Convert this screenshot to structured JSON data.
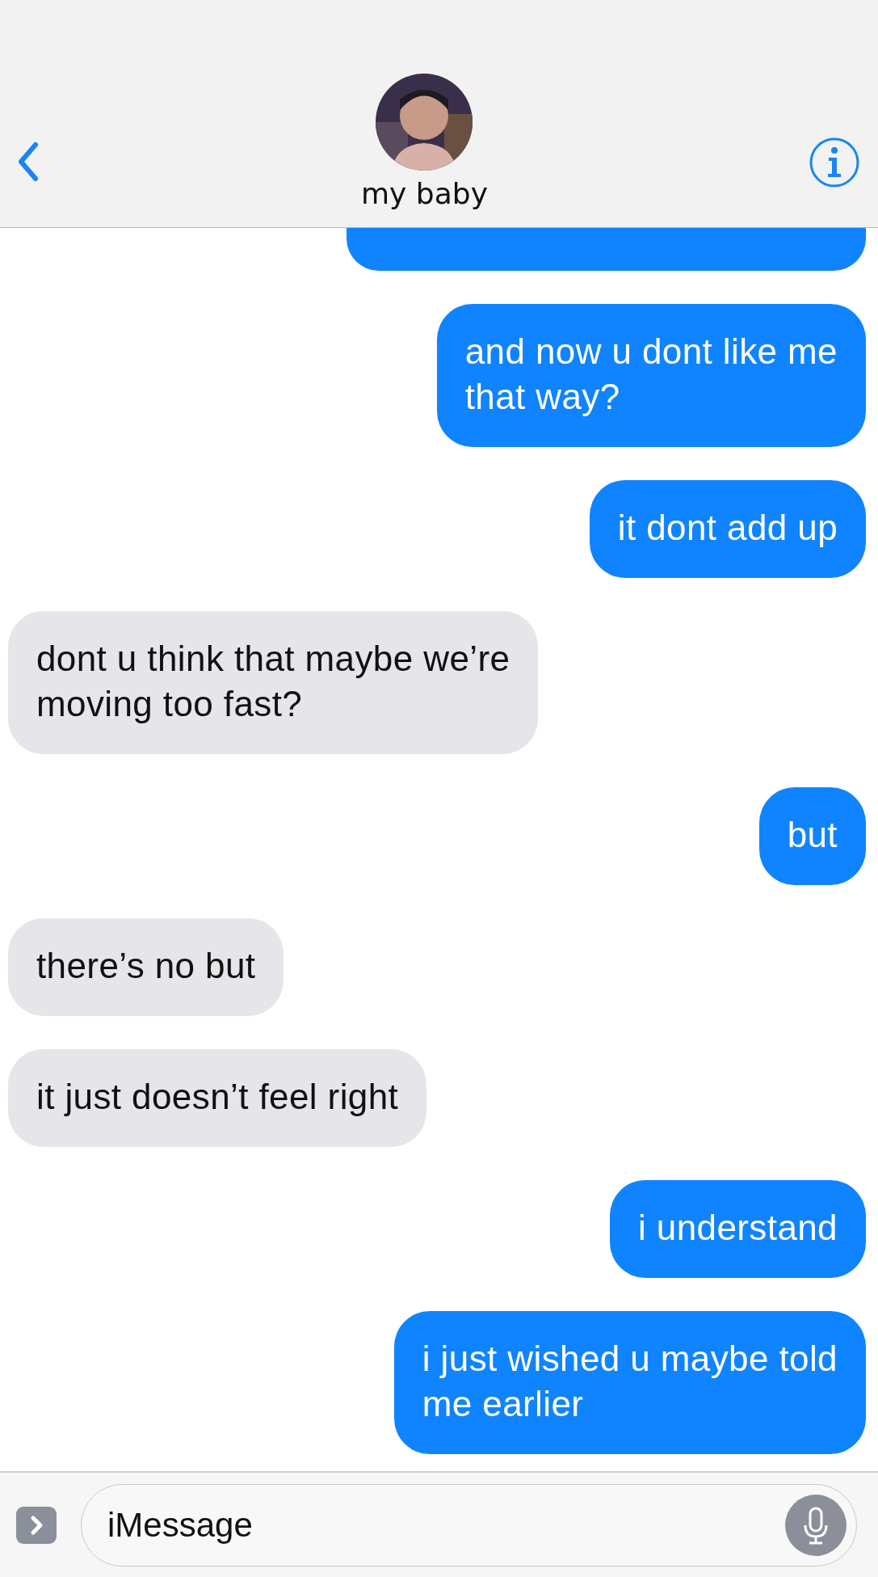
{
  "header": {
    "contact_name": "my baby"
  },
  "messages": [
    {
      "kind": "sent",
      "cut_off": true
    },
    {
      "kind": "sent",
      "cut_off": false,
      "lines": [
        "and now u dont like me",
        "that way?"
      ]
    },
    {
      "kind": "sent",
      "cut_off": false,
      "lines": [
        "it dont add up"
      ]
    },
    {
      "kind": "received",
      "cut_off": false,
      "lines": [
        "dont u think that maybe we’re",
        "moving too fast?"
      ]
    },
    {
      "kind": "sent",
      "cut_off": false,
      "lines": [
        "but"
      ]
    },
    {
      "kind": "received",
      "cut_off": false,
      "lines": [
        "there’s no but"
      ]
    },
    {
      "kind": "received",
      "cut_off": false,
      "lines": [
        "it just doesn’t feel right"
      ]
    },
    {
      "kind": "sent",
      "cut_off": false,
      "lines": [
        "i understand"
      ]
    },
    {
      "kind": "sent",
      "cut_off": false,
      "lines": [
        "i just wished u maybe told",
        "me earlier"
      ]
    }
  ],
  "composer": {
    "placeholder": "iMessage"
  }
}
